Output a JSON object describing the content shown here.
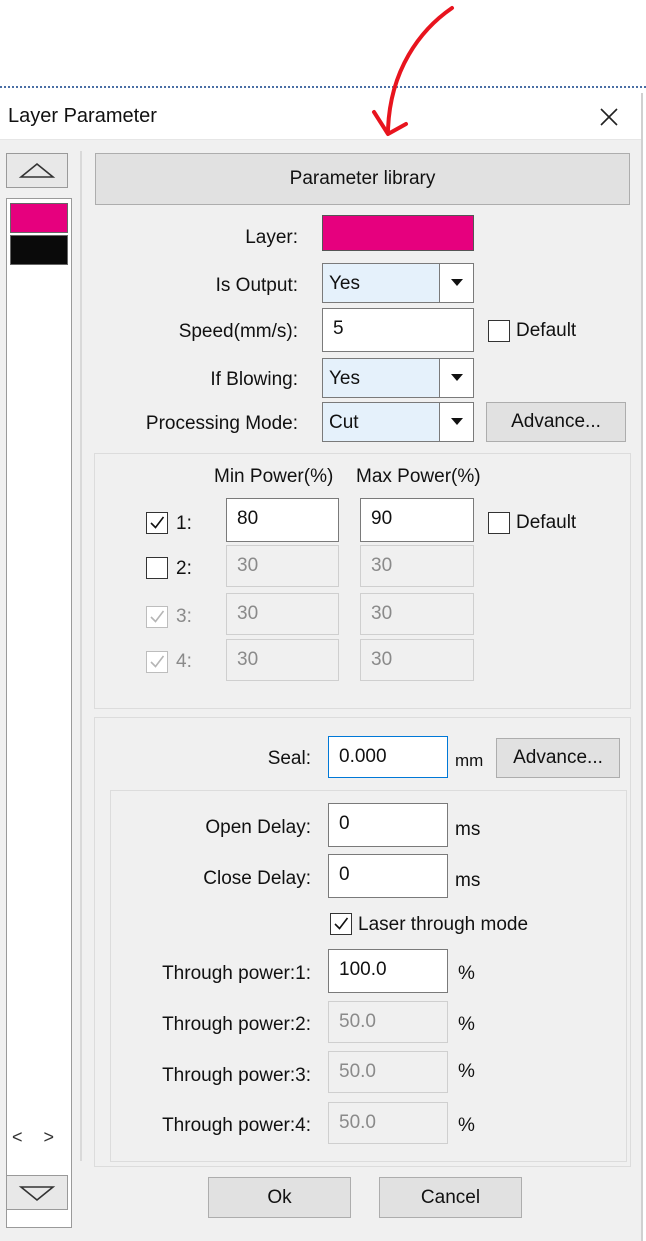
{
  "window": {
    "title": "Layer Parameter"
  },
  "toolbar": {
    "parameter_library": "Parameter library"
  },
  "layer_list": {
    "colors": [
      "#e6007e",
      "#0a0a0a"
    ],
    "hscroll_glyph": "< >"
  },
  "layer": {
    "label": "Layer:",
    "color": "#e6007e"
  },
  "is_output": {
    "label": "Is Output:",
    "value": "Yes"
  },
  "speed": {
    "label": "Speed(mm/s):",
    "value": "5",
    "default_label": "Default"
  },
  "if_blowing": {
    "label": "If Blowing:",
    "value": "Yes"
  },
  "processing_mode": {
    "label": "Processing Mode:",
    "value": "Cut",
    "advance": "Advance..."
  },
  "power": {
    "min_header": "Min Power(%)",
    "max_header": "Max Power(%)",
    "default_label": "Default",
    "rows": [
      {
        "label": "1:",
        "checked": true,
        "enabled": true,
        "min": "80",
        "max": "90"
      },
      {
        "label": "2:",
        "checked": false,
        "enabled": false,
        "min": "30",
        "max": "30"
      },
      {
        "label": "3:",
        "checked": true,
        "enabled": false,
        "min": "30",
        "max": "30"
      },
      {
        "label": "4:",
        "checked": true,
        "enabled": false,
        "min": "30",
        "max": "30"
      }
    ]
  },
  "seal": {
    "label": "Seal:",
    "value": "0.000",
    "unit": "mm",
    "advance": "Advance..."
  },
  "open_delay": {
    "label": "Open Delay:",
    "value": "0",
    "unit": "ms"
  },
  "close_delay": {
    "label": "Close Delay:",
    "value": "0",
    "unit": "ms"
  },
  "laser_through": {
    "label": "Laser through mode",
    "checked": true
  },
  "through_power": [
    {
      "label": "Through power:1:",
      "value": "100.0",
      "unit": "%",
      "enabled": true
    },
    {
      "label": "Through power:2:",
      "value": "50.0",
      "unit": "%",
      "enabled": false
    },
    {
      "label": "Through power:3:",
      "value": "50.0",
      "unit": "%",
      "enabled": false
    },
    {
      "label": "Through power:4:",
      "value": "50.0",
      "unit": "%",
      "enabled": false
    }
  ],
  "footer": {
    "ok": "Ok",
    "cancel": "Cancel"
  },
  "annotation": {
    "arrow_color": "#e8141e"
  }
}
